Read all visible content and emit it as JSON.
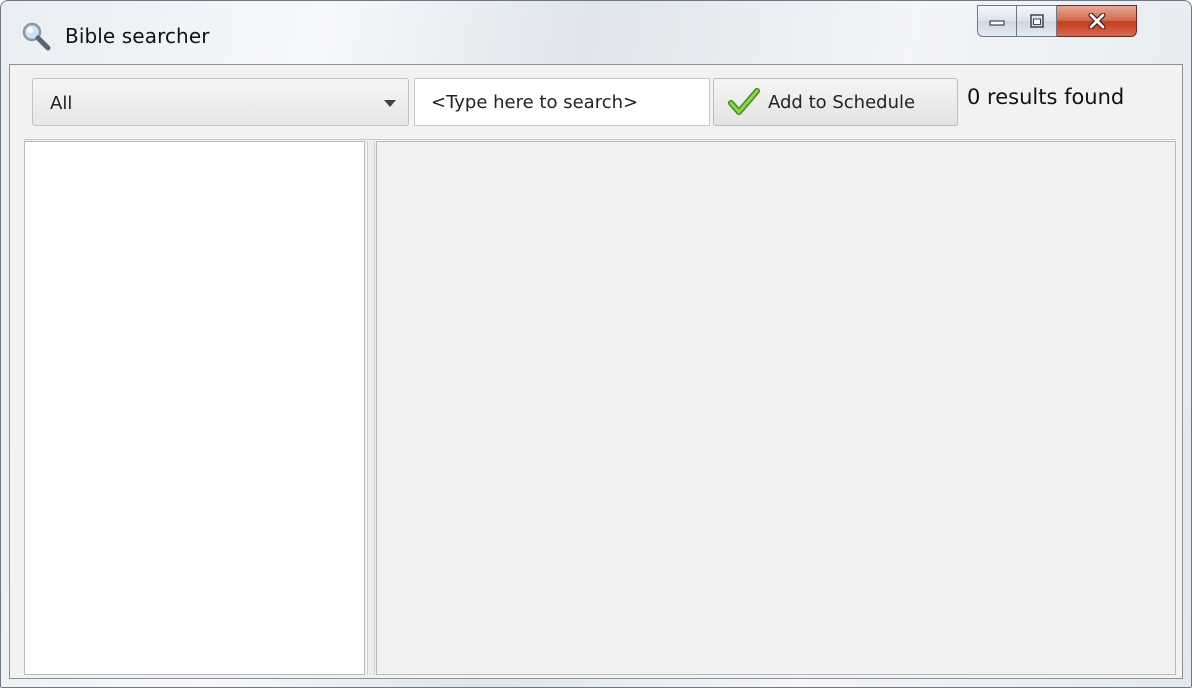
{
  "window": {
    "title": "Bible searcher",
    "icon": "magnifier-icon"
  },
  "toolbar": {
    "scope_select": {
      "value": "All",
      "icon": "chevron-down-icon"
    },
    "search": {
      "placeholder": "<Type here to search>",
      "value": ""
    },
    "add_button": {
      "label": "Add to Schedule",
      "icon": "green-checkmark-icon"
    },
    "results_text": "0 results found"
  },
  "colors": {
    "close_button": "#c94a2c",
    "window_border": "#6f7780",
    "pane_background": "#f2f2f2"
  }
}
